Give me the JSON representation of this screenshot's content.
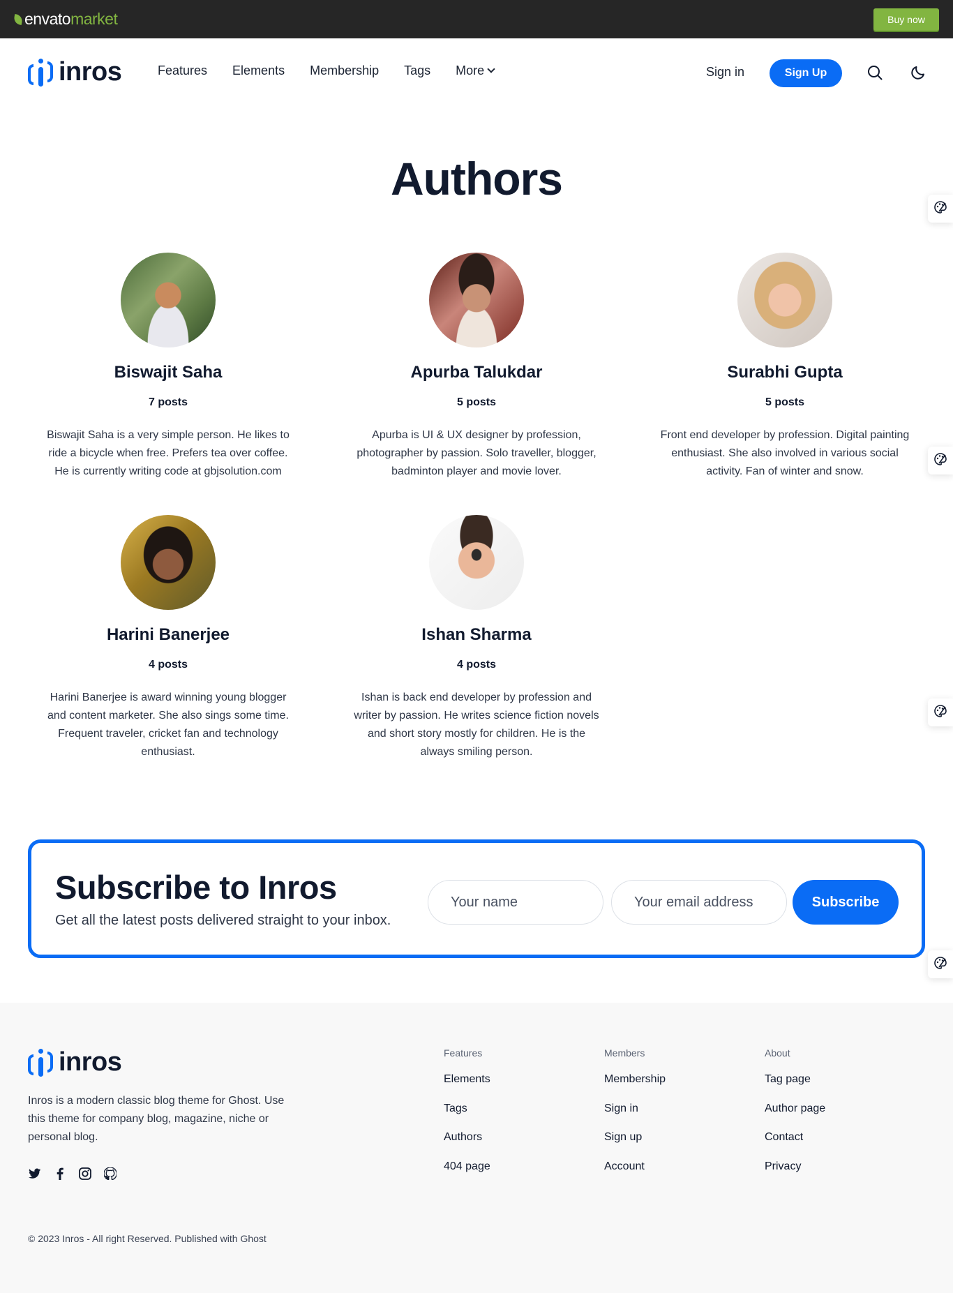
{
  "envato": {
    "logo_prefix": "envato",
    "logo_suffix": "market",
    "buy_now": "Buy now"
  },
  "header": {
    "brand": "inros",
    "nav": [
      {
        "label": "Features"
      },
      {
        "label": "Elements"
      },
      {
        "label": "Membership"
      },
      {
        "label": "Tags"
      },
      {
        "label": "More"
      }
    ],
    "sign_in": "Sign in",
    "sign_up": "Sign Up"
  },
  "page": {
    "title": "Authors"
  },
  "authors": [
    {
      "name": "Biswajit Saha",
      "posts": "7 posts",
      "bio": "Biswajit Saha is a very simple person. He likes to ride a bicycle when free. Prefers tea over coffee. He is currently writing code at gbjsolution.com"
    },
    {
      "name": "Apurba Talukdar",
      "posts": "5 posts",
      "bio": "Apurba is UI & UX designer by profession, photographer by passion. Solo traveller, blogger, badminton player and movie lover."
    },
    {
      "name": "Surabhi Gupta",
      "posts": "5 posts",
      "bio": "Front end developer by profession. Digital painting enthusiast. She also involved in various social activity. Fan of winter and snow."
    },
    {
      "name": "Harini Banerjee",
      "posts": "4 posts",
      "bio": "Harini Banerjee is award winning young blogger and content marketer. She also sings some time. Frequent traveler, cricket fan and technology enthusiast."
    },
    {
      "name": "Ishan Sharma",
      "posts": "4 posts",
      "bio": "Ishan is back end developer by profession and writer by passion. He writes science fiction novels and short story mostly for children. He is the always smiling person."
    }
  ],
  "subscribe": {
    "title": "Subscribe to Inros",
    "description": "Get all the latest posts delivered straight to your inbox.",
    "name_placeholder": "Your name",
    "email_placeholder": "Your email address",
    "button": "Subscribe"
  },
  "footer": {
    "brand": "inros",
    "description": "Inros is a modern classic blog theme for Ghost. Use this theme for company blog, magazine, niche or personal blog.",
    "socials": [
      "twitter-icon",
      "facebook-icon",
      "instagram-icon",
      "github-icon"
    ],
    "columns": [
      {
        "heading": "Features",
        "links": [
          "Elements",
          "Tags",
          "Authors",
          "404 page"
        ]
      },
      {
        "heading": "Members",
        "links": [
          "Membership",
          "Sign in",
          "Sign up",
          "Account"
        ]
      },
      {
        "heading": "About",
        "links": [
          "Tag page",
          "Author page",
          "Contact",
          "Privacy"
        ]
      }
    ],
    "copyright": "© 2023 Inros - All right Reserved. Published with Ghost"
  },
  "colors": {
    "accent": "#0a6cf5",
    "envato_green": "#82b541",
    "text_dark": "#111a2e"
  }
}
